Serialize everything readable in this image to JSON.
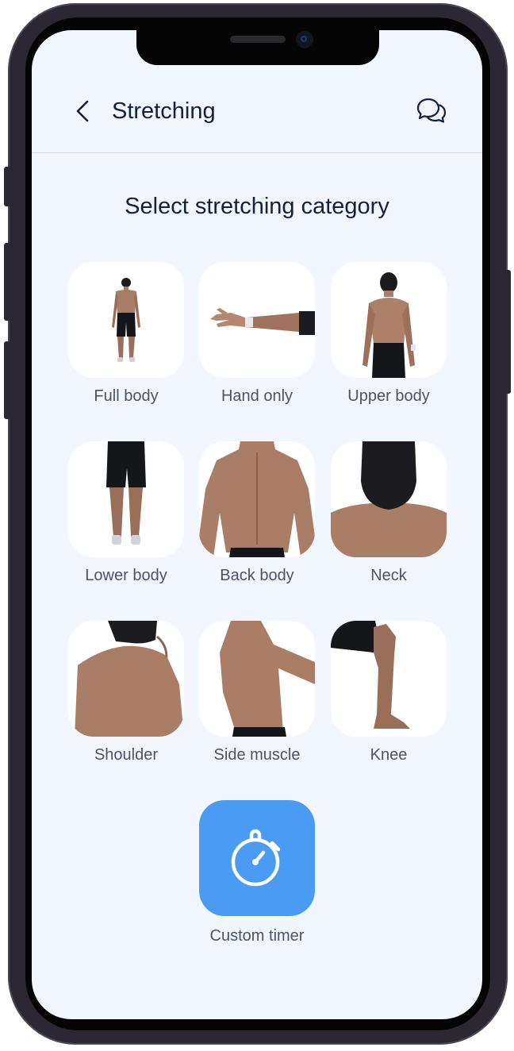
{
  "header": {
    "title": "Stretching",
    "back_icon": "chevron-left-icon",
    "chat_icon": "chat-bubbles-icon"
  },
  "section_title": "Select stretching category",
  "categories": [
    {
      "label": "Full body",
      "image": "full-body-figure"
    },
    {
      "label": "Hand only",
      "image": "arm-figure"
    },
    {
      "label": "Upper body",
      "image": "upper-body-figure"
    },
    {
      "label": "Lower body",
      "image": "legs-figure"
    },
    {
      "label": "Back body",
      "image": "back-figure"
    },
    {
      "label": "Neck",
      "image": "neck-figure"
    },
    {
      "label": "Shoulder",
      "image": "shoulder-figure"
    },
    {
      "label": "Side muscle",
      "image": "side-torso-figure"
    },
    {
      "label": "Knee",
      "image": "knee-figure"
    }
  ],
  "custom_timer": {
    "label": "Custom timer",
    "icon": "stopwatch-icon"
  },
  "colors": {
    "screen_bg": "#f1f6ff",
    "text_primary": "#14213d",
    "text_secondary": "#4a5468",
    "accent": "#4a9bf3",
    "skin": "#a97d66",
    "shorts": "#15161a"
  }
}
